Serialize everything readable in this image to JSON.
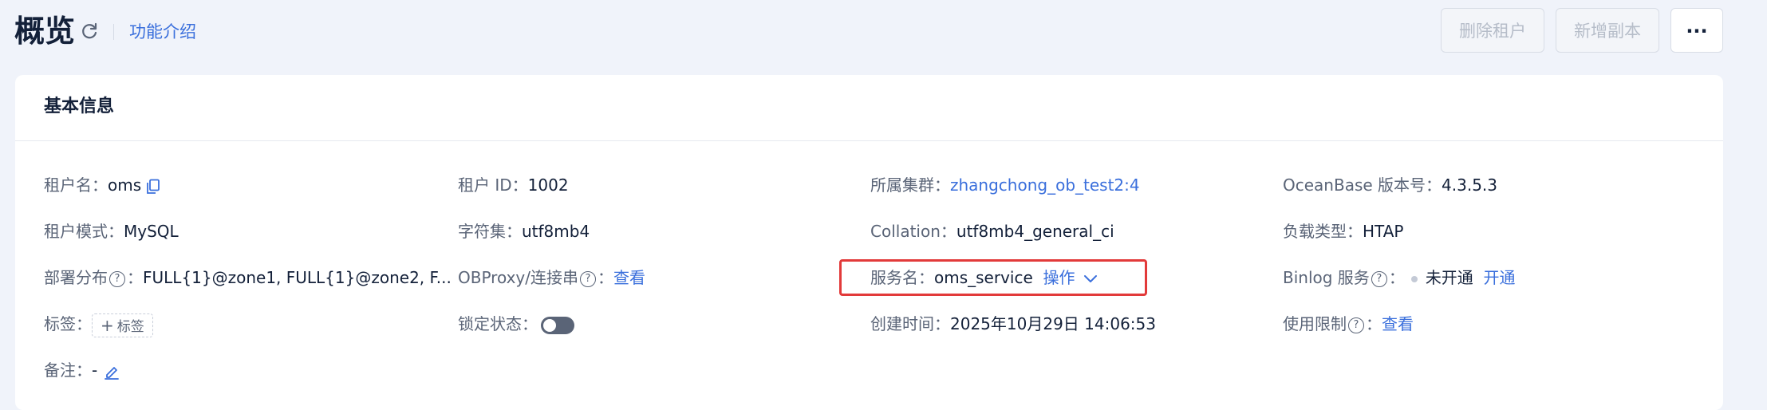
{
  "header": {
    "title": "概览",
    "feature_link": "功能介绍",
    "delete_tenant": "删除租户",
    "add_replica": "新增副本",
    "more": "···"
  },
  "basic_info": {
    "title": "基本信息",
    "tenant_name": {
      "label": "租户名：",
      "value": "oms"
    },
    "tenant_id": {
      "label": "租户 ID：",
      "value": "1002"
    },
    "cluster": {
      "label": "所属集群：",
      "value": "zhangchong_ob_test2:4"
    },
    "ob_version": {
      "label": "OceanBase 版本号：",
      "value": "4.3.5.3"
    },
    "tenant_mode": {
      "label": "租户模式：",
      "value": "MySQL"
    },
    "charset": {
      "label": "字符集：",
      "value": "utf8mb4"
    },
    "collation": {
      "label": "Collation：",
      "value": "utf8mb4_general_ci"
    },
    "workload": {
      "label": "负载类型：",
      "value": "HTAP"
    },
    "deployment": {
      "label": "部署分布",
      "value": "FULL{1}@zone1, FULL{1}@zone2, F..."
    },
    "obproxy": {
      "label": "OBProxy/连接串",
      "action": "查看"
    },
    "service_name": {
      "label": "服务名：",
      "value": "oms_service",
      "action": "操作"
    },
    "binlog": {
      "label": "Binlog 服务",
      "status": "未开通",
      "action": "开通"
    },
    "tags": {
      "label": "标签：",
      "add": "标签"
    },
    "lock_status": {
      "label": "锁定状态：",
      "value": false
    },
    "created": {
      "label": "创建时间：",
      "value": "2025年10月29日 14:06:53"
    },
    "usage_limit": {
      "label": "使用限制",
      "action": "查看"
    },
    "remark": {
      "label": "备注：",
      "value": "-"
    }
  },
  "colors": {
    "accent": "#3a6fdc",
    "highlight": "#e23a3a",
    "background": "#f0f3fa"
  }
}
